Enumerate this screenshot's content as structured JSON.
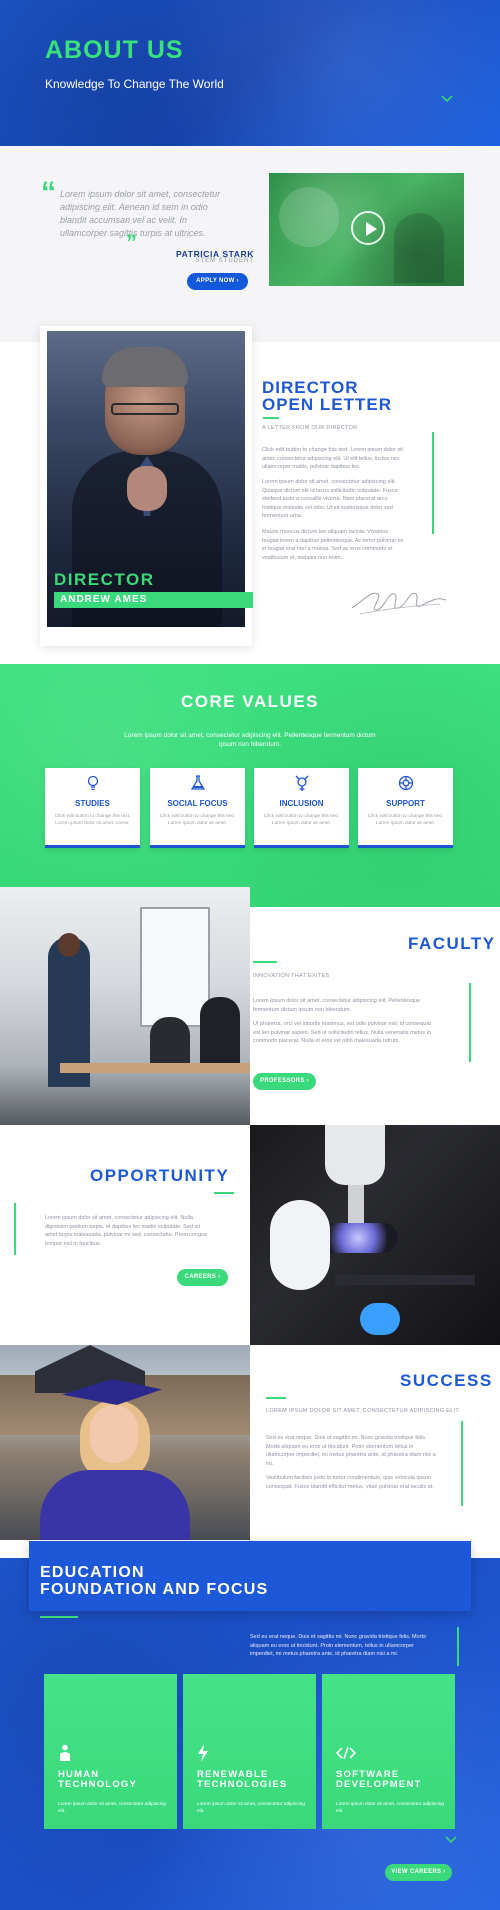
{
  "hero": {
    "title": "ABOUT US",
    "subtitle": "Knowledge To Change The World",
    "chevron_icon": "chevron-down-icon"
  },
  "testimonial": {
    "quote": "Lorem ipsum dolor sit amet, consectetur adipiscing elit. Aenean id sem in odio blandit accumsan vel ac velit. In ullamcorper sagittis turpis at ultrices.",
    "name": "PATRICIA STARK",
    "role": "STEM STUDENT",
    "apply_label": "APPLY NOW ›"
  },
  "director": {
    "label": "DIRECTOR",
    "name": "ANDREW AMES",
    "letter_title_line1": "DIRECTOR",
    "letter_title_line2": "OPEN LETTER",
    "letter_subtitle": "A LETTER FROM OUR DIRECTOR",
    "para1": "Click edit button to change this text. Lorem ipsum dolor sit amet, consectetur adipiscing elit. Ut elit tellus, luctus nec ullamcorper mattis, pulvinar dapibus leo.",
    "para2": "Lorem ipsum dolor sit amet, consectetur adipiscing elit. Quisque dictum elit id lacus sollicitudin vulputate. Fusce eleifend justo a convallis viverra. Nam placerat arcu tristique molestie vel odio. Ut sit scelerisque dolor sed fermentum urna.",
    "para3": "Mauris rhoncus dictum leo aliquam lacinia. Vivamus feugiat lorem a dapibus pellentesque. Ac tortor pulvinar ex in feugiat erat non a massa. Sed ac eros commodo et vestibulum et, sodales non enim."
  },
  "core_values": {
    "title": "CORE VALUES",
    "subtitle": "Lorem ipsum dolor sit amet, consectetur adipiscing elit. Pellentesque fermentum dictum ipsum non bibendum.",
    "items": [
      {
        "name": "STUDIES",
        "icon": "lightbulb-icon",
        "desc": "Click edit button to change this text. Lorem ipsum dolor sit amet, conse."
      },
      {
        "name": "SOCIAL FOCUS",
        "icon": "flask-icon",
        "desc": "Click edit button to change this text. Lorem ipsum dolor sit amet."
      },
      {
        "name": "INCLUSION",
        "icon": "gender-icon",
        "desc": "Click edit button to change this text. Lorem ipsum dolor sit amet."
      },
      {
        "name": "SUPPORT",
        "icon": "lifebuoy-icon",
        "desc": "Click edit button to change this text. Lorem ipsum dolor sit amet."
      }
    ]
  },
  "faculty": {
    "title": "FACULTY",
    "subtitle": "INNOVATION THAT EXITES",
    "para1": "Lorem ipsum dolor sit amet, consectetur adipiscing elit. Pellentesque fermentum dictum ipsum non bibendum.",
    "para2": "Ut pharetra, orci vel lobortis maximus, est odio pulvinar nisl, id consequat est leo pulvinar sapien. Sed ut sollicitudin tellus. Nulla venenatis metus in commodo placerat. Nulla et eros vel nibh malesuada rutrum.",
    "button": "PROFESSORS ›"
  },
  "opportunity": {
    "title": "OPPORTUNITY",
    "para": "Lorem ipsum dolor sit amet, consectetur adipiscing elit. Nulla dignissim pretium turpis, et dapibus leo mattis vulputate. Sed sit amet turpis malesuada, pulvinar mi sed, consectetur. Proin congue tempor nisl in faucibus.",
    "button": "CAREERS ›"
  },
  "success": {
    "title": "SUCCESS",
    "subtitle": "LOREM IPSUM DOLOR SIT AMET, CONSECTETUR ADIPISCING ELIT.",
    "para1": "Sed eu erat neque. Duis et sagittis mi. Nunc gravida tristique felis. Morbi aliquam eu eros ut tincidunt. Proin elementum tellus in ullamcorper imperdiet, mi metus pharetra ante, id pharetra diam nisi a mi.",
    "para2": "Vestibulum facilisis justo in tortor condimentum, quis vehicula ipsum consequat. Fusce blandit efficitur metus, vitae pulvinar erat iaculis at."
  },
  "education": {
    "title_line1": "EDUCATION",
    "title_line2": "FOUNDATION AND FOCUS",
    "para": "Sed eu erat neque. Duis et sagittis mi. Nunc gravida tristique felis. Morbi aliquam eu eros ut tincidunt. Proin elementum, tellus in ullamcorper imperdiet, mi metus pharetra ante, id pharetra diam nisi a mi.",
    "cards": [
      {
        "line1": "HUMAN",
        "line2": "TECHNOLOGY",
        "icon": "person-icon",
        "desc": "Lorem ipsum dolor sit amet, consectetur adipiscing elit."
      },
      {
        "line1": "RENEWABLE",
        "line2": "TECHNOLOGIES",
        "icon": "lightning-icon",
        "desc": "Lorem ipsum dolor sit amet, consectetur adipiscing elit."
      },
      {
        "line1": "SOFTWARE",
        "line2": "DEVELOPMENT",
        "icon": "code-icon",
        "desc": "Lorem ipsum dolor sit amet, consectetur adipiscing elit."
      }
    ],
    "button": "VIEW CAREERS ›"
  },
  "colors": {
    "green": "#3ad97b",
    "blue": "#1e58d4",
    "dark_blue": "#1b3f94"
  }
}
